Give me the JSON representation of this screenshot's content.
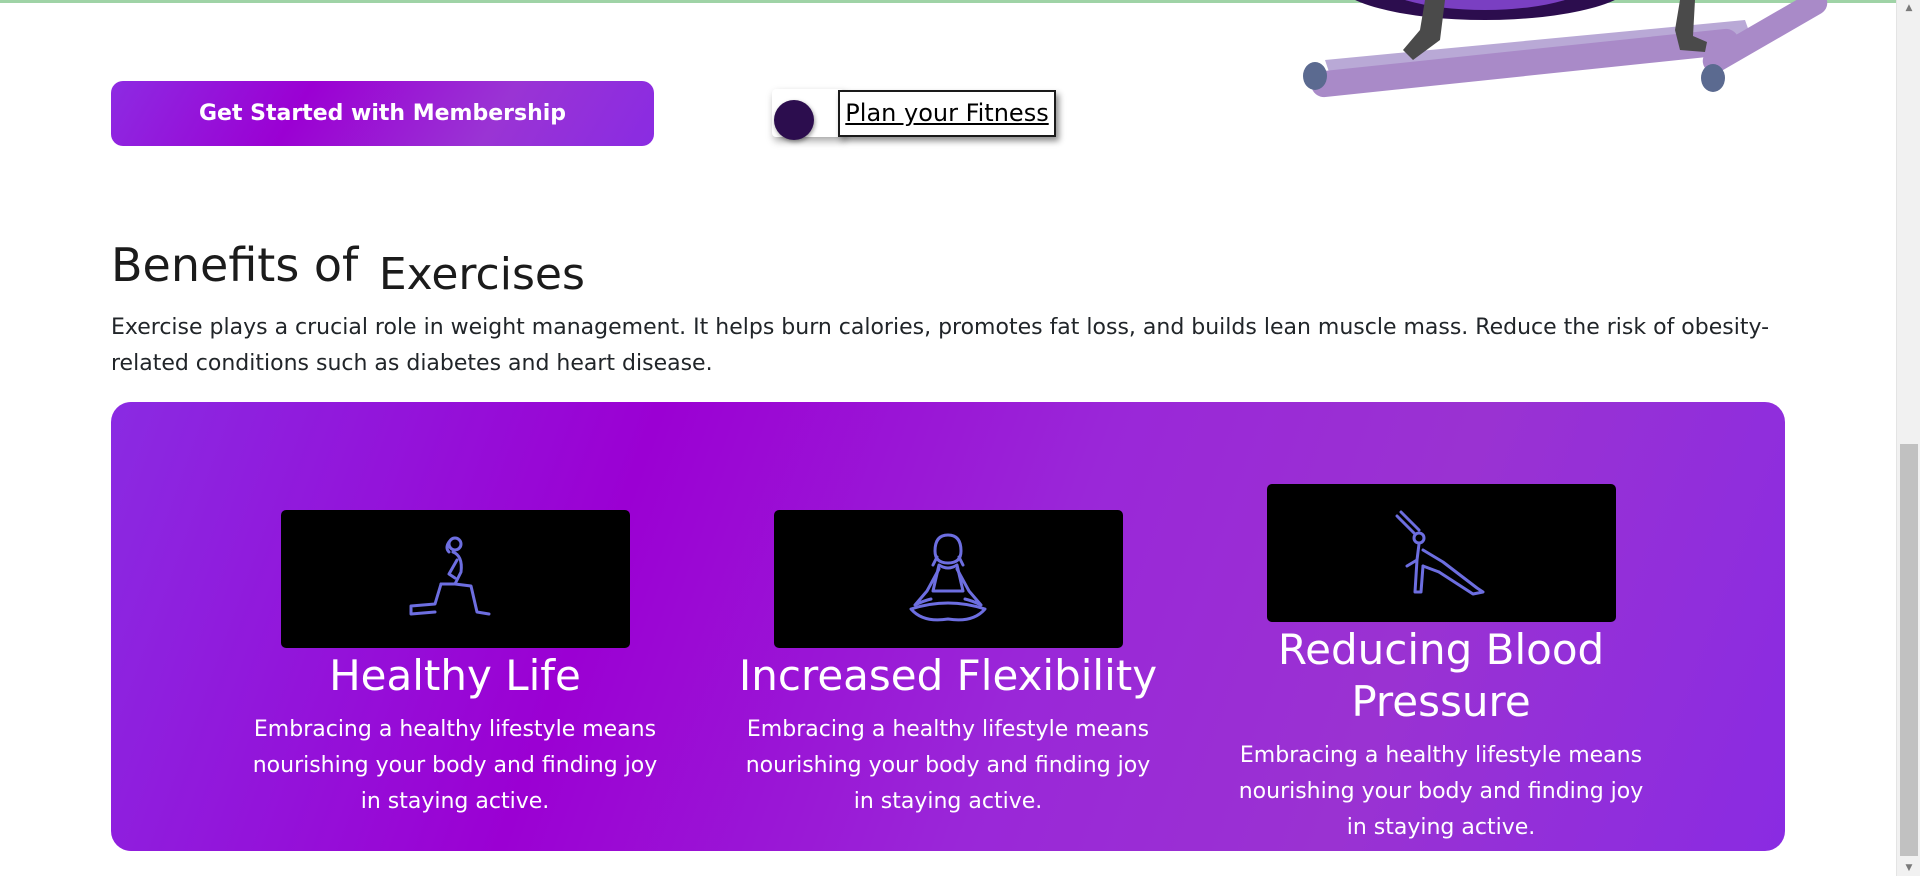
{
  "cta": {
    "membership_label": "Get Started with Membership",
    "plan_label": "Plan your Fitness"
  },
  "benefits": {
    "title_part1": "Benefits of",
    "title_part2": "Exercises",
    "intro": "Exercise plays a crucial role in weight management. It helps burn calories, promotes fat loss, and builds lean muscle mass. Reduce the risk of obesity-related conditions such as diabetes and heart disease.",
    "cards": [
      {
        "icon": "lunge-exercise-icon",
        "title": "Healthy Life",
        "text": "Embracing a healthy lifestyle means nourishing your body and finding joy in staying active."
      },
      {
        "icon": "meditation-icon",
        "title": "Increased Flexibility",
        "text": "Embracing a healthy lifestyle means nourishing your body and finding joy in staying active."
      },
      {
        "icon": "side-stretch-yoga-icon",
        "title": "Reducing Blood Pressure",
        "text": "Embracing a healthy lifestyle means nourishing your body and finding joy in staying active."
      }
    ]
  },
  "colors": {
    "accent": "#9b00d3",
    "accent_light": "#8a2be2",
    "icon_stroke": "#6d6ee0",
    "dot": "#2c0d4e"
  }
}
